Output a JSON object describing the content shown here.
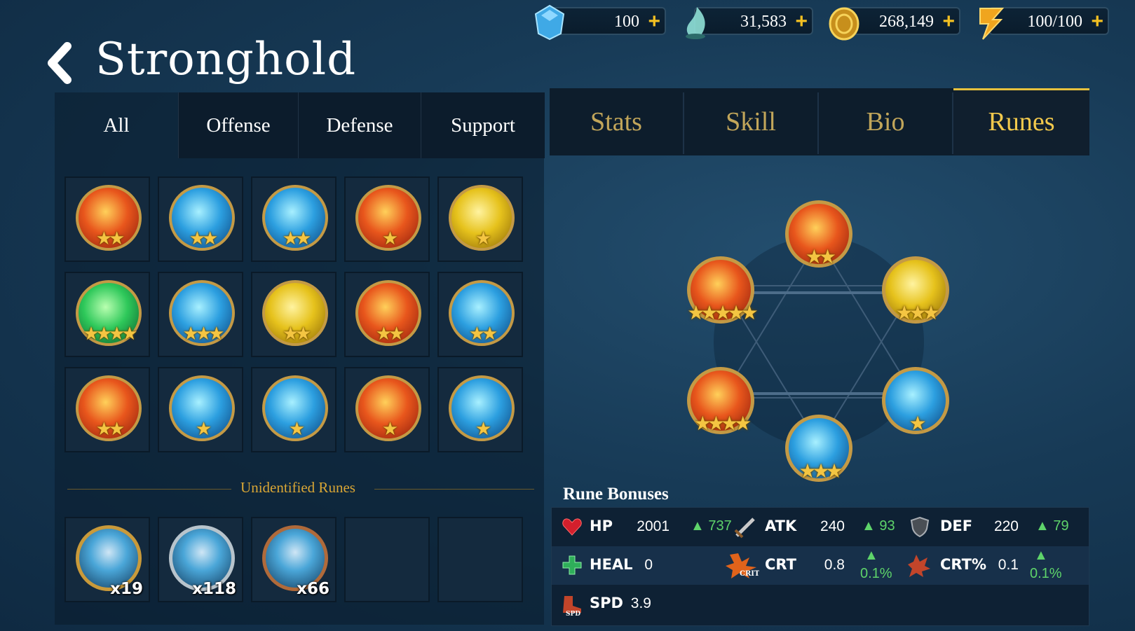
{
  "currency": [
    {
      "icon": "gem-icon",
      "value": "100"
    },
    {
      "icon": "spirit-flame-icon",
      "value": "31,583"
    },
    {
      "icon": "gold-coin-icon",
      "value": "268,149"
    },
    {
      "icon": "energy-bolt-icon",
      "value": "100/100"
    }
  ],
  "plus_symbol": "+",
  "title": "Stronghold",
  "filter_tabs": [
    "All",
    "Offense",
    "Defense",
    "Support"
  ],
  "detail_tabs": [
    "Stats",
    "Skill",
    "Bio",
    "Runes"
  ],
  "active_detail_tab": "Runes",
  "rune_grid": [
    {
      "element": "fire",
      "stars": "★★"
    },
    {
      "element": "ice",
      "stars": "★★"
    },
    {
      "element": "ice",
      "stars": "★★"
    },
    {
      "element": "fire",
      "stars": "★"
    },
    {
      "element": "gold",
      "stars": "★"
    },
    {
      "element": "nature",
      "stars": "★★★★"
    },
    {
      "element": "ice",
      "stars": "★★★"
    },
    {
      "element": "gold",
      "stars": "★★"
    },
    {
      "element": "fire",
      "stars": "★★"
    },
    {
      "element": "ice",
      "stars": "★★"
    },
    {
      "element": "fire",
      "stars": "★★"
    },
    {
      "element": "ice",
      "stars": "★"
    },
    {
      "element": "ice",
      "stars": "★"
    },
    {
      "element": "fire",
      "stars": "★"
    },
    {
      "element": "ice",
      "stars": "★"
    }
  ],
  "unidentified_label": "Unidentified Runes",
  "unidentified": [
    {
      "tier": "gold",
      "count": "x19"
    },
    {
      "tier": "silver",
      "count": "x118"
    },
    {
      "tier": "bronze",
      "count": "x66"
    }
  ],
  "equipped_runes": [
    {
      "element": "fire",
      "stars": "★★"
    },
    {
      "element": "gold",
      "stars": "★★★"
    },
    {
      "element": "ice",
      "stars": "★"
    },
    {
      "element": "ice",
      "stars": "★★★"
    },
    {
      "element": "fire",
      "stars": "★★★★"
    },
    {
      "element": "fire",
      "stars": "★★★★★"
    }
  ],
  "rune_bonuses_label": "Rune Bonuses",
  "bonuses": [
    [
      {
        "icon": "heart-icon",
        "name": "HP",
        "value": "2001",
        "inc": "▲ 737"
      },
      {
        "icon": "sword-icon",
        "name": "ATK",
        "value": "240",
        "inc": "▲ 93"
      },
      {
        "icon": "shield-icon",
        "name": "DEF",
        "value": "220",
        "inc": "▲ 79"
      }
    ],
    [
      {
        "icon": "heal-cross-icon",
        "name": "HEAL",
        "value": "0",
        "inc": ""
      },
      {
        "icon": "crit-burst-icon",
        "name": "CRT",
        "value": "0.8",
        "inc_arrow": "▲",
        "inc": "0.1%"
      },
      {
        "icon": "crit-damage-icon",
        "name": "CRT%",
        "value": "0.1",
        "inc_arrow": "▲",
        "inc": "0.1%"
      }
    ],
    [
      {
        "icon": "speed-boot-icon",
        "name": "SPD",
        "value": "3.9",
        "inc": ""
      }
    ]
  ],
  "crit_icon_text": "CRIT",
  "spd_icon_text": "SPD",
  "colors": {
    "accent": "#f2c94c",
    "tab_inactive": "#c2a65a",
    "increase": "#5ed46a"
  }
}
